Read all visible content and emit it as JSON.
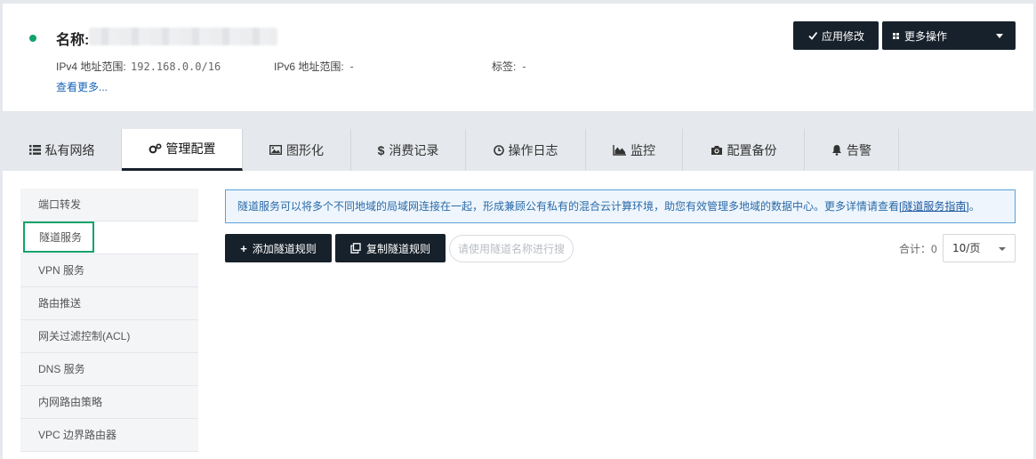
{
  "header": {
    "name_label": "名称:",
    "name_value": "",
    "ipv4_label": "IPv4 地址范围:",
    "ipv4_value": "192.168.0.0/16",
    "ipv6_label": "IPv6 地址范围:",
    "ipv6_value": "-",
    "tags_label": "标签:",
    "tags_value": "-",
    "view_more": "查看更多...",
    "apply_button": "应用修改",
    "more_actions_button": "更多操作",
    "status_color": "#11a36a"
  },
  "tabs": [
    {
      "label": "私有网络",
      "icon": "list-icon"
    },
    {
      "label": "管理配置",
      "icon": "gears-icon",
      "active": true
    },
    {
      "label": "图形化",
      "icon": "image-icon"
    },
    {
      "label": "消费记录",
      "icon": "dollar-icon"
    },
    {
      "label": "操作日志",
      "icon": "clock-icon"
    },
    {
      "label": "监控",
      "icon": "area-chart-icon"
    },
    {
      "label": "配置备份",
      "icon": "camera-icon"
    },
    {
      "label": "告警",
      "icon": "bell-icon"
    }
  ],
  "sidebar": {
    "items": [
      {
        "label": "端口转发"
      },
      {
        "label": "隧道服务",
        "active": true
      },
      {
        "label": "VPN 服务"
      },
      {
        "label": "路由推送"
      },
      {
        "label": "网关过滤控制(ACL)"
      },
      {
        "label": "DNS 服务"
      },
      {
        "label": "内网路由策略"
      },
      {
        "label": "VPC 边界路由器"
      }
    ]
  },
  "main": {
    "notice_text": "隧道服务可以将多个不同地域的局域网连接在一起，形成兼顾公有私有的混合云计算环境，助您有效管理多地域的数据中心。更多详情请查看",
    "notice_link": "[隧道服务指南]",
    "notice_end": "。",
    "add_button": "添加隧道规则",
    "copy_button": "复制隧道规则",
    "search_placeholder": "请使用隧道名称进行搜",
    "total_label": "合计：0",
    "page_size": "10/页"
  }
}
